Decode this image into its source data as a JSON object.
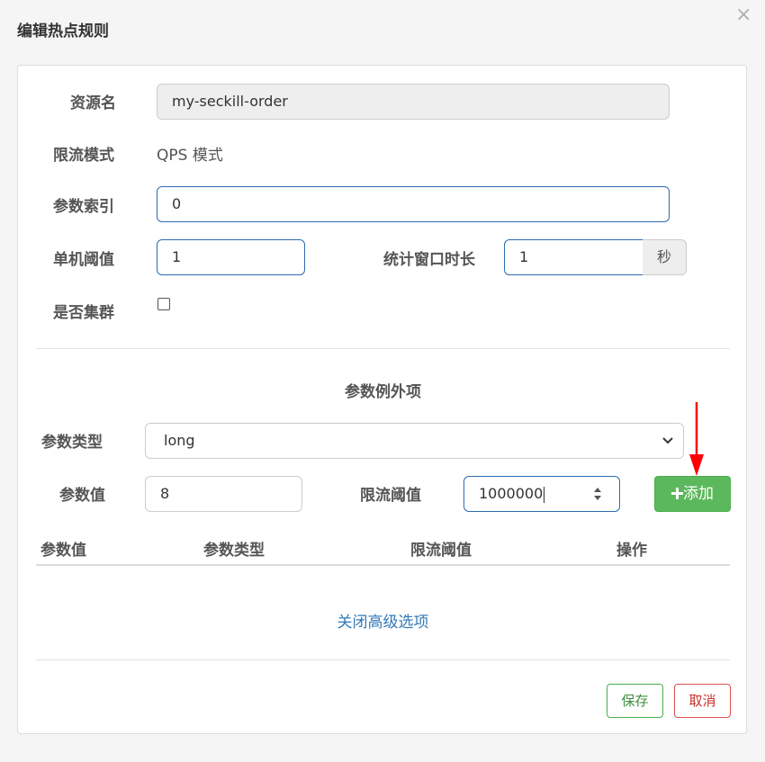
{
  "dialog": {
    "title": "编辑热点规则",
    "close_glyph": "×"
  },
  "form": {
    "resource_label": "资源名",
    "resource_value": "my-seckill-order",
    "mode_label": "限流模式",
    "mode_value": "QPS 模式",
    "param_index_label": "参数索引",
    "param_index_value": "0",
    "threshold_label": "单机阈值",
    "threshold_value": "1",
    "window_label": "统计窗口时长",
    "window_value": "1",
    "window_unit": "秒",
    "cluster_label": "是否集群",
    "cluster_checked": false
  },
  "exceptions": {
    "section_title": "参数例外项",
    "param_type_label": "参数类型",
    "param_type_value": "long",
    "param_value_label": "参数值",
    "param_value": "8",
    "limit_label": "限流阈值",
    "limit_value": "1000000",
    "add_button_icon": "plus-icon",
    "add_button_label": "添加",
    "table_headers": [
      "参数值",
      "参数类型",
      "限流阈值",
      "操作"
    ],
    "rows": []
  },
  "advanced_link": "关闭高级选项",
  "footer": {
    "save_label": "保存",
    "cancel_label": "取消"
  },
  "colors": {
    "accent_border": "#2c6cb0",
    "success": "#5cb85c",
    "danger": "#d9534f",
    "link": "#337ab7",
    "annotation_arrow": "#ff0000"
  }
}
